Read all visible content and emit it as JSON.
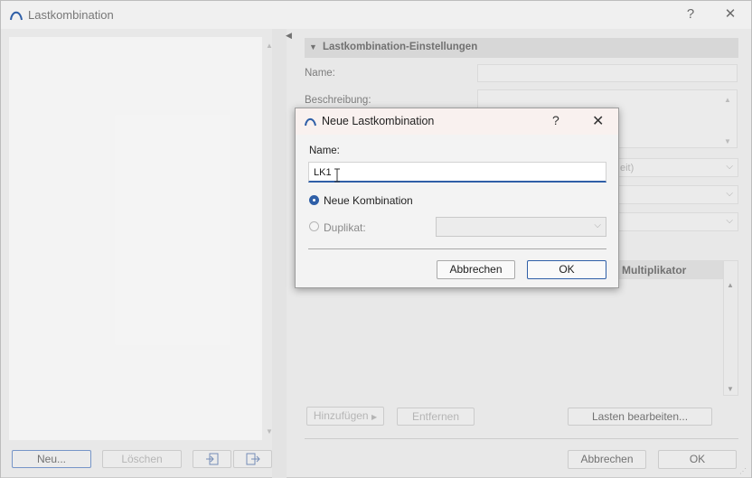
{
  "window": {
    "title": "Lastkombination",
    "help": "?",
    "close": "✕"
  },
  "left_panel": {
    "buttons": {
      "new": "Neu...",
      "delete": "Löschen"
    }
  },
  "settings": {
    "header": "Lastkombination-Einstellungen",
    "name_label": "Name:",
    "description_label": "Beschreibung:",
    "dropdown1_partial": "eit)",
    "table_col_multiplier": "Multiplikator",
    "buttons": {
      "add": "Hinzufügen",
      "remove": "Entfernen",
      "edit_loads": "Lasten bearbeiten..."
    }
  },
  "footer": {
    "cancel": "Abbrechen",
    "ok": "OK"
  },
  "dialog": {
    "title": "Neue Lastkombination",
    "help": "?",
    "close": "✕",
    "name_label": "Name:",
    "name_value": "LK1",
    "radio_new": {
      "label": "Neue Kombination",
      "checked": true
    },
    "radio_duplicate": {
      "label": "Duplikat:",
      "checked": false
    },
    "duplicate_value": "",
    "cancel": "Abbrechen",
    "ok": "OK"
  },
  "colors": {
    "accent": "#2f5fa7"
  }
}
